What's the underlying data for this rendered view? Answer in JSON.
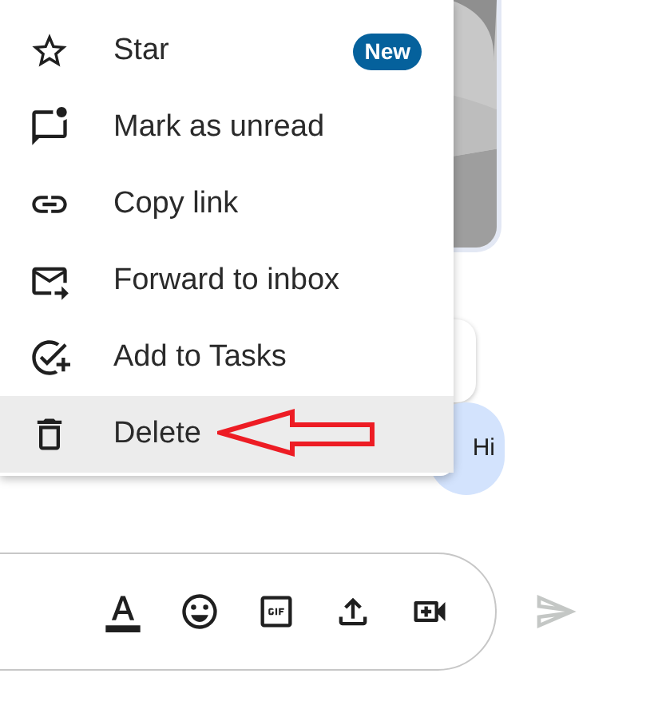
{
  "menu": {
    "items": [
      {
        "label": "Star",
        "badge": "New",
        "highlighted": false
      },
      {
        "label": "Mark as unread",
        "highlighted": false
      },
      {
        "label": "Copy link",
        "highlighted": false
      },
      {
        "label": "Forward to inbox",
        "highlighted": false
      },
      {
        "label": "Add to Tasks",
        "highlighted": false
      },
      {
        "label": "Delete",
        "highlighted": true
      }
    ]
  },
  "message": {
    "text": "Hi"
  }
}
